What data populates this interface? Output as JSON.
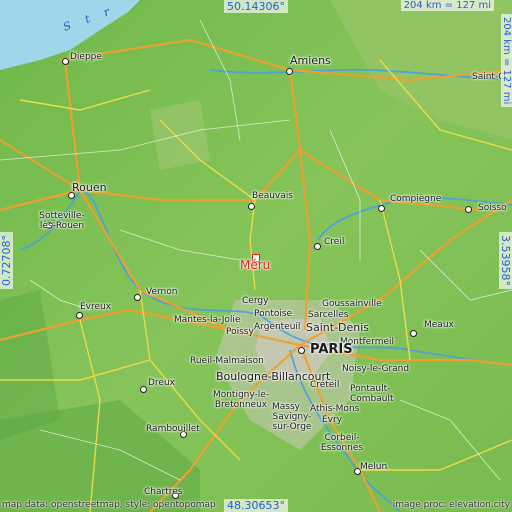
{
  "map": {
    "coords": {
      "north": "50.14306°",
      "south": "48.30653°",
      "west": "0.72708°",
      "east": "3.53958°"
    },
    "scale_top": "204 km = 127 mi",
    "scale_right": "204 km = 127 mi",
    "credit_left": "map data: openstreetmap, style: opentopomap",
    "credit_right": "image proc: elevation.city",
    "sea_label": "S t r",
    "highlight": "Méru",
    "cities": [
      {
        "name": "Dieppe",
        "key": "dieppe"
      },
      {
        "name": "Amiens",
        "key": "amiens"
      },
      {
        "name": "Saint-C",
        "key": "saintq"
      },
      {
        "name": "Rouen",
        "key": "rouen"
      },
      {
        "name": "Sotteville-lès-Rouen",
        "key": "sotteville"
      },
      {
        "name": "Beauvais",
        "key": "beauvais"
      },
      {
        "name": "Compiègne",
        "key": "compiegne"
      },
      {
        "name": "Soisso",
        "key": "soissons"
      },
      {
        "name": "Creil",
        "key": "creil"
      },
      {
        "name": "Vernon",
        "key": "vernon"
      },
      {
        "name": "Évreux",
        "key": "evreux"
      },
      {
        "name": "Cergy",
        "key": "cergy"
      },
      {
        "name": "Goussainville",
        "key": "goussainville"
      },
      {
        "name": "Pontoise",
        "key": "pontoise"
      },
      {
        "name": "Sarcelles",
        "key": "sarcelles"
      },
      {
        "name": "Mantes-la-Jolie",
        "key": "mantes"
      },
      {
        "name": "Argenteuil",
        "key": "argenteuil"
      },
      {
        "name": "Saint-Denis",
        "key": "saintdenis"
      },
      {
        "name": "Meaux",
        "key": "meaux"
      },
      {
        "name": "Poissy",
        "key": "poissy"
      },
      {
        "name": "Montfermeil",
        "key": "montfermeil"
      },
      {
        "name": "PARIS",
        "key": "paris"
      },
      {
        "name": "Rueil-Malmaison",
        "key": "rueil"
      },
      {
        "name": "Noisy-le-Grand",
        "key": "noisy"
      },
      {
        "name": "Dreux",
        "key": "dreux"
      },
      {
        "name": "Boulogne-Billancourt",
        "key": "boulogne"
      },
      {
        "name": "Créteil",
        "key": "creteil"
      },
      {
        "name": "Pontault-Combault",
        "key": "pontault"
      },
      {
        "name": "Montigny-le-Bretonneux",
        "key": "montigny"
      },
      {
        "name": "Massy",
        "key": "massy"
      },
      {
        "name": "Athis-Mons",
        "key": "athis"
      },
      {
        "name": "Rambouillet",
        "key": "rambouillet"
      },
      {
        "name": "Savigny-sur-Orge",
        "key": "savigny"
      },
      {
        "name": "Évry",
        "key": "evry"
      },
      {
        "name": "Corbeil-Essonnes",
        "key": "corbeil"
      },
      {
        "name": "Melun",
        "key": "melun"
      },
      {
        "name": "Chartres",
        "key": "chartres"
      }
    ]
  }
}
